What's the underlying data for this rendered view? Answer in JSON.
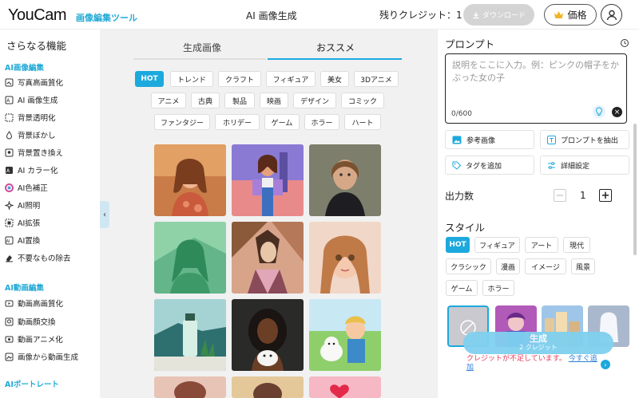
{
  "header": {
    "logo": "YouCam",
    "logo_sub": "画像編集ツール",
    "title": "AI 画像生成",
    "credits": "残りクレジット：1",
    "download_label": "ダウンロード",
    "price_label": "価格"
  },
  "sidebar": {
    "title": "さらなる機能",
    "section_image": "AI画像編集",
    "image_items": [
      "写真高画質化",
      "AI 画像生成",
      "背景透明化",
      "背景ぼかし",
      "背景置き換え",
      "AI カラー化",
      "AI色補正",
      "AI照明",
      "AI拡張",
      "AI置換",
      "不要なもの除去"
    ],
    "section_video": "AI動画編集",
    "video_items": [
      "動画高画質化",
      "動画顔交換",
      "動画アニメ化",
      "画像から動画生成"
    ],
    "section_portrait": "AIポートレート"
  },
  "center": {
    "tabs": [
      "生成画像",
      "おススメ"
    ],
    "active_tab": 1,
    "tags": [
      "HOT",
      "トレンド",
      "クラフト",
      "フィギュア",
      "美女",
      "3Dアニメ",
      "アニメ",
      "古典",
      "製品",
      "映画",
      "デザイン",
      "コミック",
      "ファンタジー",
      "ホリデー",
      "ゲーム",
      "ホラー",
      "ハート"
    ]
  },
  "right": {
    "prompt_title": "プロンプト",
    "prompt_placeholder": "説明をここに入力。例：ピンクの帽子をかぶった女の子",
    "prompt_count": "0/600",
    "buttons": [
      "参考画像",
      "プロンプトを抽出",
      "タグを追加",
      "詳細設定"
    ],
    "output_label": "出力数",
    "output_value": "1",
    "style_title": "スタイル",
    "style_tags": [
      "HOT",
      "フィギュア",
      "アート",
      "現代",
      "クラシック",
      "漫画",
      "イメージ",
      "風景",
      "ゲーム",
      "ホラー"
    ],
    "generate_label": "生成",
    "generate_sub": "2 クレジット",
    "warning": "クレジットが不足しています。",
    "warning_link": "今すぐ追加"
  },
  "colors": {
    "accent": "#1ca9dd",
    "warning": "#e83a5b",
    "link": "#2e7fd6"
  }
}
